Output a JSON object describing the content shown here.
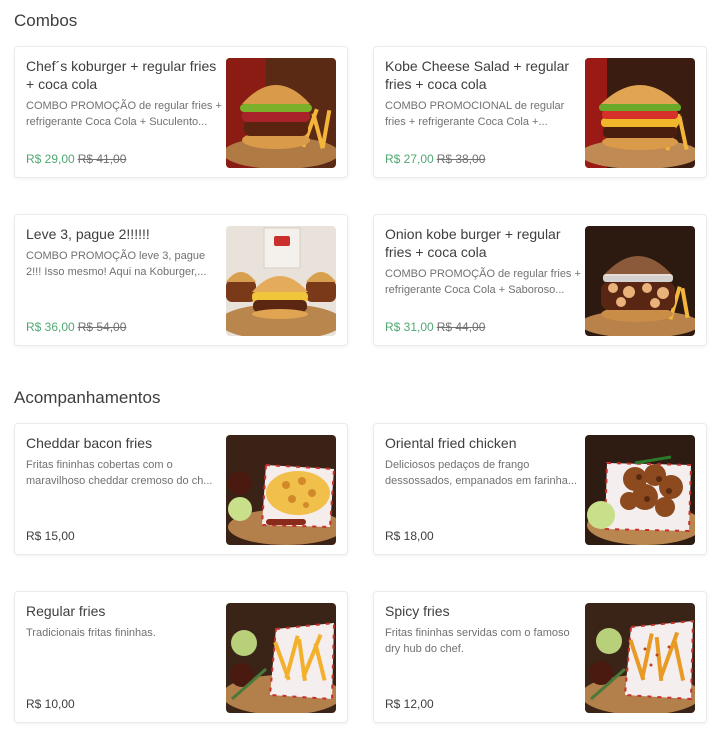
{
  "sections": [
    {
      "title": "Combos",
      "items": [
        {
          "name": "Chef´s koburger + regular fries + coca cola",
          "description": "COMBO PROMOÇÃO de regular fries + refrigerante Coca Cola + Suculento...",
          "price": "R$ 29,00",
          "old_price": "R$ 41,00",
          "image": "burger-bacon-photo"
        },
        {
          "name": "Kobe Cheese Salad + regular fries + coca cola",
          "description": "COMBO PROMOCIONAL de regular fries + refrigerante Coca Cola +...",
          "price": "R$ 27,00",
          "old_price": "R$ 38,00",
          "image": "burger-salad-photo"
        },
        {
          "name": "Leve 3, pague 2!!!!!!",
          "description": "COMBO PROMOÇÃO leve 3, pague 2!!! Isso mesmo! Aqui na Koburger,...",
          "price": "R$ 36,00",
          "old_price": "R$ 54,00",
          "image": "three-burgers-photo"
        },
        {
          "name": "Onion kobe burger + regular fries + coca cola",
          "description": "COMBO PROMOÇÃO de regular fries + refrigerante Coca Cola + Saboroso...",
          "price": "R$ 31,00",
          "old_price": "R$ 44,00",
          "image": "onion-burger-photo"
        }
      ]
    },
    {
      "title": "Acompanhamentos",
      "items": [
        {
          "name": "Cheddar bacon fries",
          "description": "Fritas fininhas cobertas com o maravilhoso cheddar cremoso do ch...",
          "price": "R$ 15,00",
          "old_price": "",
          "image": "cheddar-fries-photo"
        },
        {
          "name": "Oriental fried chicken",
          "description": "Deliciosos pedaços de frango dessossados, empanados em farinha...",
          "price": "R$ 18,00",
          "old_price": "",
          "image": "fried-chicken-photo"
        },
        {
          "name": "Regular fries",
          "description": "Tradicionais fritas fininhas.",
          "price": "R$ 10,00",
          "old_price": "",
          "image": "regular-fries-photo"
        },
        {
          "name": "Spicy fries",
          "description": "Fritas fininhas servidas com o famoso dry hub do chef.",
          "price": "R$ 12,00",
          "old_price": "",
          "image": "spicy-fries-photo"
        }
      ]
    }
  ],
  "colors": {
    "promo_price": "#50a773",
    "text": "#3e3e3e",
    "muted": "#717171"
  }
}
